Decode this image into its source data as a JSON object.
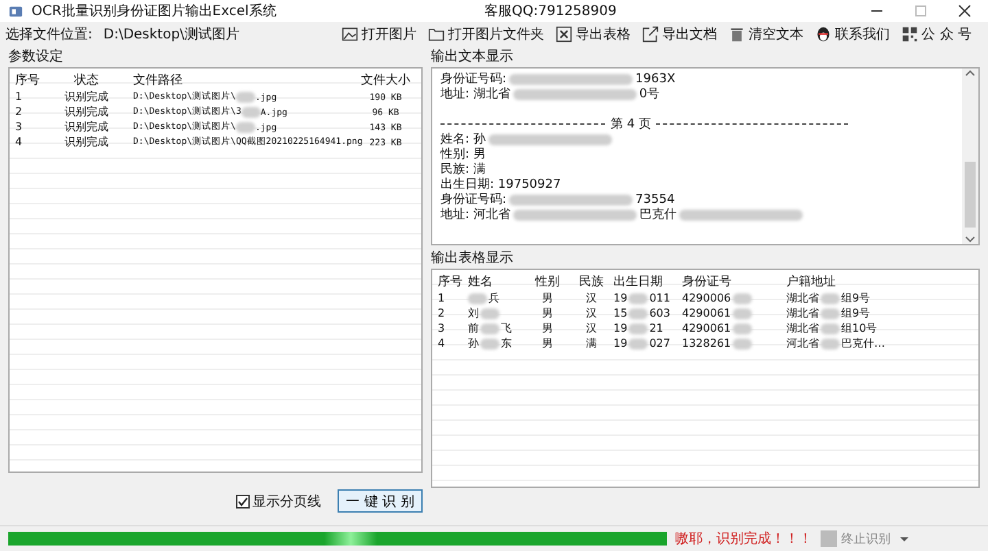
{
  "window": {
    "title": "OCR批量识别身份证图片输出Excel系统",
    "center_text": "客服QQ:791258909"
  },
  "toolbar": {
    "path_label": "选择文件位置:",
    "path_value": "D:\\Desktop\\测试图片",
    "buttons": [
      {
        "label": "打开图片",
        "kind": "image"
      },
      {
        "label": "打开图片文件夹",
        "kind": "folder"
      },
      {
        "label": "导出表格",
        "kind": "excel"
      },
      {
        "label": "导出文档",
        "kind": "export"
      },
      {
        "label": "清空文本",
        "kind": "trash"
      },
      {
        "label": "联系我们",
        "kind": "contact"
      },
      {
        "label": "公 众 号",
        "kind": "qr"
      }
    ]
  },
  "params": {
    "title": "参数设定",
    "columns": [
      "序号",
      "状态",
      "文件路径",
      "文件大小"
    ],
    "rows": [
      {
        "no": "1",
        "status": "识别完成",
        "path": [
          "D:\\Desktop\\测试图片\\",
          {
            "kind": "blur"
          },
          ".jpg"
        ],
        "size": "190 KB"
      },
      {
        "no": "2",
        "status": "识别完成",
        "path": [
          "D:\\Desktop\\测试图片\\3",
          {
            "kind": "blur"
          },
          "A.jpg"
        ],
        "size": "96 KB"
      },
      {
        "no": "3",
        "status": "识别完成",
        "path": [
          "D:\\Desktop\\测试图片\\",
          {
            "kind": "blur"
          },
          ".jpg"
        ],
        "size": "143 KB"
      },
      {
        "no": "4",
        "status": "识别完成",
        "path": [
          "D:\\Desktop\\测试图片\\QQ截图20210225164941.png"
        ],
        "size": "223 KB"
      }
    ]
  },
  "text_output": {
    "title": "输出文本显示",
    "lines": [
      {
        "kind": "text",
        "parts": [
          "身份证号码:",
          {
            "kind": "blur"
          },
          "1963X"
        ]
      },
      {
        "kind": "text",
        "parts": [
          "地址:  湖北省",
          {
            "kind": "blur"
          },
          "0号"
        ]
      },
      {
        "kind": "blank"
      },
      {
        "kind": "separator",
        "parts": [
          "第 4 页"
        ]
      },
      {
        "kind": "text",
        "parts": [
          "姓名:  孙",
          {
            "kind": "blur"
          }
        ]
      },
      {
        "kind": "text",
        "parts": [
          "性别:  男"
        ]
      },
      {
        "kind": "text",
        "parts": [
          "民族:  满"
        ]
      },
      {
        "kind": "text",
        "parts": [
          "出生日期:  19750927"
        ]
      },
      {
        "kind": "text",
        "parts": [
          "身份证号码:",
          {
            "kind": "blur"
          },
          "73554"
        ]
      },
      {
        "kind": "text",
        "parts": [
          "地址:  河北省",
          {
            "kind": "blur"
          },
          "巴克什",
          {
            "kind": "blur"
          }
        ]
      }
    ]
  },
  "table_output": {
    "title": "输出表格显示",
    "columns": [
      "序号",
      "姓名",
      "性别",
      "民族",
      "出生日期",
      "身份证号",
      "户籍地址"
    ],
    "rows": [
      [
        [
          "1"
        ],
        [
          {
            "kind": "blur"
          },
          "兵"
        ],
        [
          "男"
        ],
        [
          "汉"
        ],
        [
          "19",
          {
            "kind": "blur"
          },
          "011"
        ],
        [
          "4290006",
          {
            "kind": "blur"
          }
        ],
        [
          "湖北省",
          {
            "kind": "blur"
          },
          "组9号"
        ]
      ],
      [
        [
          "2"
        ],
        [
          "刘",
          {
            "kind": "blur"
          }
        ],
        [
          "男"
        ],
        [
          "汉"
        ],
        [
          "15",
          {
            "kind": "blur"
          },
          "603"
        ],
        [
          "4290061",
          {
            "kind": "blur"
          }
        ],
        [
          "湖北省",
          {
            "kind": "blur"
          },
          "组9号"
        ]
      ],
      [
        [
          "3"
        ],
        [
          "前",
          {
            "kind": "blur"
          },
          "飞"
        ],
        [
          "男"
        ],
        [
          "汉"
        ],
        [
          "19",
          {
            "kind": "blur"
          },
          "21"
        ],
        [
          "4290061",
          {
            "kind": "blur"
          }
        ],
        [
          "湖北省",
          {
            "kind": "blur"
          },
          "组10号"
        ]
      ],
      [
        [
          "4"
        ],
        [
          "孙",
          {
            "kind": "blur"
          },
          "东"
        ],
        [
          "男"
        ],
        [
          "满"
        ],
        [
          "19",
          {
            "kind": "blur"
          },
          "027"
        ],
        [
          "1328261",
          {
            "kind": "blur"
          }
        ],
        [
          "河北省",
          {
            "kind": "blur"
          },
          "巴克什…"
        ]
      ]
    ]
  },
  "controls": {
    "show_page_lines": {
      "label": "显示分页线",
      "checked": true
    },
    "recognize_button": "一 键 识 别"
  },
  "status_bar": {
    "progress": {
      "level": 1
    },
    "message": "嗷耶，识别完成！！！",
    "stop_button": {
      "label": "终止识别",
      "disabled": true
    }
  }
}
